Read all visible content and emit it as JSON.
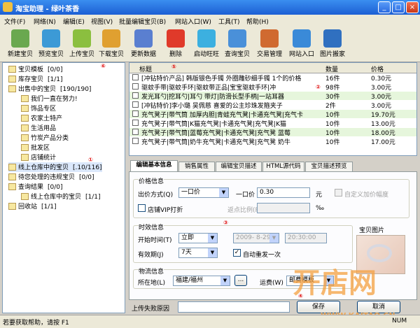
{
  "window": {
    "title": "淘宝助理 - 绿叶茶香",
    "min": "_",
    "max": "□",
    "close": "×"
  },
  "menu": [
    "文件(F)",
    "网络(N)",
    "编辑(E)",
    "视图(V)",
    "批量编辑宝贝(B)",
    "网站入口(W)",
    "工具(T)",
    "帮助(H)"
  ],
  "toolbar": [
    {
      "label": "新建宝贝",
      "icon": "new-item-icon",
      "color": "#6aa84f"
    },
    {
      "label": "预览宝贝",
      "icon": "preview-icon",
      "color": "#3c9ad6"
    },
    {
      "label": "上传宝贝",
      "icon": "upload-icon",
      "color": "#8bbf3f"
    },
    {
      "label": "下载宝贝",
      "icon": "download-icon",
      "color": "#e0a030"
    },
    {
      "label": "更新数据",
      "icon": "update-data-icon",
      "color": "#5a7fd0"
    },
    {
      "label": "删除",
      "icon": "delete-icon",
      "color": "#e03a2a"
    },
    {
      "label": "启动旺旺",
      "icon": "wangwang-icon",
      "color": "#3cb0e0"
    },
    {
      "label": "查询宝贝",
      "icon": "search-icon",
      "color": "#4a90d9"
    },
    {
      "label": "交易管理",
      "icon": "trade-icon",
      "color": "#d06a30"
    },
    {
      "label": "网站入口",
      "icon": "website-icon",
      "color": "#3a8ad8"
    },
    {
      "label": "图片搬家",
      "icon": "image-move-icon",
      "color": "#3070c0"
    }
  ],
  "tree": [
    {
      "label": "宝贝模板",
      "count": "[0/0]"
    },
    {
      "label": "库存宝贝",
      "count": "[1/1]"
    },
    {
      "label": "出售中的宝贝",
      "count": "[190/190]"
    },
    {
      "label": "我们一直在努力!",
      "count": ""
    },
    {
      "label": "饰品专区",
      "count": ""
    },
    {
      "label": "农家土特产",
      "count": ""
    },
    {
      "label": "生活用品",
      "count": ""
    },
    {
      "label": "竹炭产品分类",
      "count": ""
    },
    {
      "label": "批发区",
      "count": ""
    },
    {
      "label": "店铺统计",
      "count": ""
    },
    {
      "label": "线上仓库中的宝贝",
      "count": "[.10/116]"
    },
    {
      "label": "待您处理的违规宝贝",
      "count": "[0/0]"
    },
    {
      "label": "查询结果",
      "count": "[0/0]"
    },
    {
      "label": "线上仓库中的宝贝",
      "count": "[1/1]"
    },
    {
      "label": "回收站",
      "count": "[1/1]"
    }
  ],
  "grid": {
    "headers": [
      "标题",
      "数量",
      "价格"
    ],
    "rows": [
      {
        "title": "[冲钻特价产品] 韩版银色手镯 外圈雕砂细手镯 1个的价格",
        "qty": "16件",
        "price": "0.30元"
      },
      {
        "title": "驱蚊手带|驱蚊手环|驱蚊带正品|宝宝驱蚊手环|冲",
        "qty": "98件",
        "price": "3.00元"
      },
      {
        "title": "发光耳勺|挖耳勺|耳勺 带灯|防滑长型手柄|一站耳器",
        "qty": "30件",
        "price": "3.00元"
      },
      {
        "title": "[冲钻特价]李小璐 吴佩慈 喜爱的公主珍珠发箍夹子",
        "qty": "2件",
        "price": "3.00元"
      },
      {
        "title": "充气凳子|带气筒 加厚内胆|青蛙充气凳|卡通充气凳|充气卡",
        "qty": "10件",
        "price": "19.70元"
      },
      {
        "title": "充气凳子|带气筒|K猫充气凳|卡通充气凳|充气凳|K猫",
        "qty": "10件",
        "price": "13.00元"
      },
      {
        "title": "充气凳子|带气筒|蓝莓充气凳|卡通充气凳|充气凳 蓝莓",
        "qty": "10件",
        "price": "18.00元"
      },
      {
        "title": "充气凳子|带气筒|奶牛充气凳|卡通充气凳|充气凳 奶牛",
        "qty": "10件",
        "price": "17.00元"
      }
    ]
  },
  "tabs": [
    "编辑基本信息",
    "销售属性",
    "编辑宝贝描述",
    "HTML源代码",
    "宝贝描述预览"
  ],
  "form": {
    "price_section": "价格信息",
    "sale_type_label": "出价方式(Q)",
    "sale_type_value": "一口价",
    "fixed_price_label": "一口价",
    "fixed_price_value": "0.30",
    "yuan": "元",
    "custom_markup_label": "自定义加价幅度",
    "vip_label": "店铺VIP打折",
    "rebate_label": "返点比例(R)",
    "percent": "‰",
    "time_section": "时效信息",
    "start_label": "开始时间(T)",
    "start_value": "立即",
    "date_value": "2009- 8-29",
    "time_value": "20:30:00",
    "valid_label": "有效期(J)",
    "valid_value": "7天",
    "auto_relist_label": "自动重发一次",
    "logistics_section": "物流信息",
    "location_label": "所在地(L)",
    "location_value": "福建/福州",
    "more_button": "...",
    "shipping_label": "运费(W)",
    "shipping_value": "邮费模板",
    "image_label": "宝贝图片",
    "upload_fail_label": "上传失败原因",
    "save_button": "保存",
    "cancel_button": "取消"
  },
  "status": {
    "help": "若要获取帮助，请按 F1",
    "num": "NUM"
  },
  "annotations": [
    "①",
    "②",
    "③",
    "④",
    "⑤",
    "⑥"
  ],
  "watermark": {
    "text": "开店网",
    "url": "WWW.KAITAO.CN"
  }
}
